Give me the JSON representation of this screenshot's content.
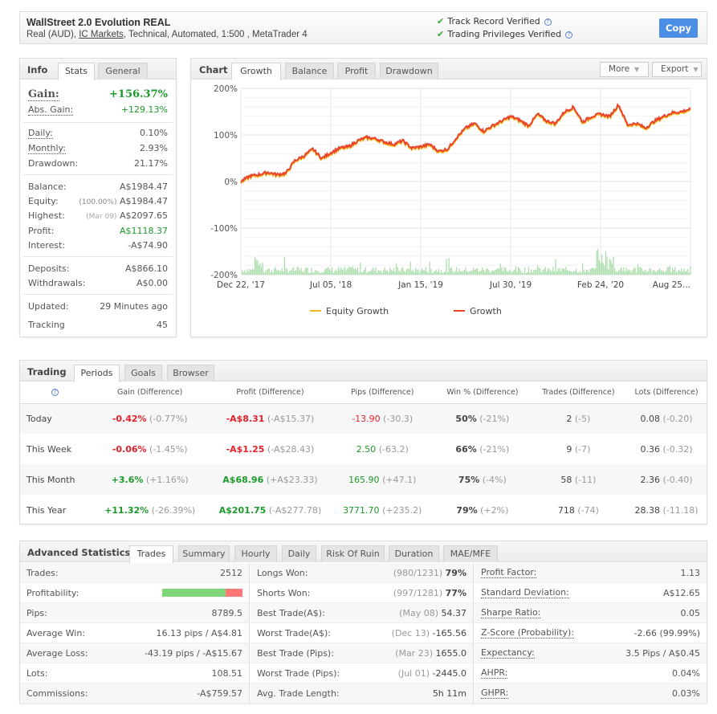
{
  "header": {
    "title": "WallStreet 2.0 Evolution REAL",
    "sub_prefix": "Real (AUD), ",
    "broker": "IC Markets",
    "sub_suffix": ", Technical, Automated, 1:500 , MetaTrader 4",
    "verified": [
      "Track Record Verified",
      "Trading Privileges Verified"
    ],
    "copy_label": "Copy"
  },
  "info": {
    "label": "Info",
    "tabs": [
      "Stats",
      "General"
    ],
    "gain_label": "Gain:",
    "gain_value": "+156.37%",
    "abs_gain_label": "Abs. Gain:",
    "abs_gain_value": "+129.13%",
    "daily_label": "Daily:",
    "daily_value": "0.10%",
    "monthly_label": "Monthly:",
    "monthly_value": "2.93%",
    "drawdown_label": "Drawdown:",
    "drawdown_value": "21.17%",
    "balance_label": "Balance:",
    "balance_value": "A$1984.47",
    "equity_label": "Equity:",
    "equity_note": "(100.00%)",
    "equity_value": "A$1984.47",
    "highest_label": "Highest:",
    "highest_note": "(Mar 09)",
    "highest_value": "A$2097.65",
    "profit_label": "Profit:",
    "profit_value": "A$1118.37",
    "interest_label": "Interest:",
    "interest_value": "-A$74.90",
    "deposits_label": "Deposits:",
    "deposits_value": "A$866.10",
    "withdrawals_label": "Withdrawals:",
    "withdrawals_value": "A$0.00",
    "updated_label": "Updated:",
    "updated_value": "29 Minutes ago",
    "tracking_label": "Tracking",
    "tracking_value": "45"
  },
  "chartpanel": {
    "label": "Chart",
    "tabs": [
      "Growth",
      "Balance",
      "Profit",
      "Drawdown"
    ],
    "more_label": "More",
    "export_label": "Export"
  },
  "chart_data": {
    "type": "line",
    "title": "",
    "xlabel": "",
    "ylabel": "",
    "ylim": [
      -200,
      200
    ],
    "yticks": [
      "200%",
      "100%",
      "0%",
      "-100%",
      "-200%"
    ],
    "ytick_values": [
      200,
      100,
      0,
      -100,
      -200
    ],
    "xticks": [
      "Dec 22, '17",
      "Jul 05, '18",
      "Jan 15, '19",
      "Jul 30, '19",
      "Feb 24, '20",
      "Aug 25..."
    ],
    "xtick_positions": [
      0,
      0.2,
      0.4,
      0.6,
      0.8,
      1.0
    ],
    "grid": true,
    "legend": [
      "Equity Growth",
      "Growth"
    ],
    "legend_position": "bottom",
    "colors": {
      "growth": "#e8432c",
      "equity": "#f5b820",
      "volume": "#a8dca8"
    },
    "series": [
      {
        "name": "Growth",
        "x": [
          0,
          0.02,
          0.04,
          0.06,
          0.08,
          0.1,
          0.12,
          0.14,
          0.16,
          0.18,
          0.2,
          0.22,
          0.24,
          0.26,
          0.28,
          0.3,
          0.32,
          0.34,
          0.36,
          0.38,
          0.4,
          0.42,
          0.44,
          0.46,
          0.48,
          0.5,
          0.52,
          0.54,
          0.56,
          0.58,
          0.6,
          0.62,
          0.64,
          0.66,
          0.68,
          0.7,
          0.72,
          0.74,
          0.76,
          0.78,
          0.8,
          0.82,
          0.84,
          0.86,
          0.88,
          0.9,
          0.92,
          0.94,
          0.96,
          0.98,
          1.0
        ],
        "values": [
          0,
          12,
          15,
          20,
          15,
          18,
          45,
          55,
          70,
          50,
          62,
          72,
          75,
          88,
          95,
          92,
          85,
          80,
          88,
          72,
          75,
          80,
          65,
          70,
          95,
          115,
          125,
          108,
          120,
          130,
          140,
          132,
          120,
          145,
          130,
          125,
          150,
          160,
          128,
          140,
          145,
          140,
          165,
          122,
          125,
          115,
          130,
          140,
          148,
          150,
          156
        ]
      },
      {
        "name": "Equity Growth",
        "values_note": "tracks Growth closely with small dips",
        "min_dip": 105
      }
    ]
  },
  "trading": {
    "label": "Trading",
    "tabs": [
      "Periods",
      "Goals",
      "Browser"
    ],
    "columns": [
      "Gain (Difference)",
      "Profit (Difference)",
      "Pips (Difference)",
      "Win % (Difference)",
      "Trades (Difference)",
      "Lots (Difference)"
    ],
    "rows": [
      {
        "period": "Today",
        "gain": "-0.42%",
        "gain_diff": "(-0.77%)",
        "profit": "-A$8.31",
        "profit_diff": "(-A$15.37)",
        "pips": "-13.90",
        "pips_diff": "(-30.3)",
        "win": "50%",
        "win_diff": "(-21%)",
        "trades": "2",
        "trades_diff": "(-5)",
        "lots": "0.08",
        "lots_diff": "(-0.20)",
        "gain_color": "red",
        "profit_color": "red",
        "pips_color": "red"
      },
      {
        "period": "This Week",
        "gain": "-0.06%",
        "gain_diff": "(-1.45%)",
        "profit": "-A$1.25",
        "profit_diff": "(-A$28.43)",
        "pips": "2.50",
        "pips_diff": "(-63.2)",
        "win": "66%",
        "win_diff": "(-21%)",
        "trades": "9",
        "trades_diff": "(-7)",
        "lots": "0.36",
        "lots_diff": "(-0.32)",
        "gain_color": "red",
        "profit_color": "red",
        "pips_color": "green"
      },
      {
        "period": "This Month",
        "gain": "+3.6%",
        "gain_diff": "(+1.16%)",
        "profit": "A$68.96",
        "profit_diff": "(+A$23.33)",
        "pips": "165.90",
        "pips_diff": "(+47.1)",
        "win": "75%",
        "win_diff": "(-4%)",
        "trades": "58",
        "trades_diff": "(-11)",
        "lots": "2.36",
        "lots_diff": "(-0.40)",
        "gain_color": "green",
        "profit_color": "green",
        "pips_color": "green"
      },
      {
        "period": "This Year",
        "gain": "+11.32%",
        "gain_diff": "(-26.39%)",
        "profit": "A$201.75",
        "profit_diff": "(-A$277.78)",
        "pips": "3771.70",
        "pips_diff": "(+235.2)",
        "win": "79%",
        "win_diff": "(+2%)",
        "trades": "718",
        "trades_diff": "(-74)",
        "lots": "28.38",
        "lots_diff": "(-11.18)",
        "gain_color": "green",
        "profit_color": "green",
        "pips_color": "green"
      }
    ]
  },
  "advanced": {
    "label": "Advanced Statistics",
    "tabs": [
      "Trades",
      "Summary",
      "Hourly",
      "Daily",
      "Risk Of Ruin",
      "Duration",
      "MAE/MFE"
    ],
    "col1": [
      {
        "label": "Trades:",
        "value": "2512"
      },
      {
        "label": "Profitability:",
        "bar_win_fraction": 0.79
      },
      {
        "label": "Pips:",
        "value": "8789.5"
      },
      {
        "label": "Average Win:",
        "value": "16.13 pips / A$4.81"
      },
      {
        "label": "Average Loss:",
        "value": "-43.19 pips / -A$15.67"
      },
      {
        "label": "Lots:",
        "value": "108.51"
      },
      {
        "label": "Commissions:",
        "value": "-A$759.57"
      }
    ],
    "col2": [
      {
        "label": "Longs Won:",
        "note": "(980/1231)",
        "value": "79%"
      },
      {
        "label": "Shorts Won:",
        "note": "(997/1281)",
        "value": "77%"
      },
      {
        "label": "Best Trade(A$):",
        "note": "(May 08)",
        "value": "54.37"
      },
      {
        "label": "Worst Trade(A$):",
        "note": "(Dec 13)",
        "value": "-165.56"
      },
      {
        "label": "Best Trade (Pips):",
        "note": "(Mar 23)",
        "value": "1655.0"
      },
      {
        "label": "Worst Trade (Pips):",
        "note": "(Jul 01)",
        "value": "-2445.0"
      },
      {
        "label": "Avg. Trade Length:",
        "note": "",
        "value": "5h 11m"
      }
    ],
    "col3": [
      {
        "label": "Profit Factor:",
        "value": "1.13"
      },
      {
        "label": "Standard Deviation:",
        "value": "A$12.65"
      },
      {
        "label": "Sharpe Ratio:",
        "value": "0.05"
      },
      {
        "label": "Z-Score (Probability):",
        "value": "-2.66 (99.99%)"
      },
      {
        "label": "Expectancy:",
        "value": "3.5 Pips / A$0.45"
      },
      {
        "label": "AHPR:",
        "value": "0.04%"
      },
      {
        "label": "GHPR:",
        "value": "0.03%"
      }
    ]
  }
}
